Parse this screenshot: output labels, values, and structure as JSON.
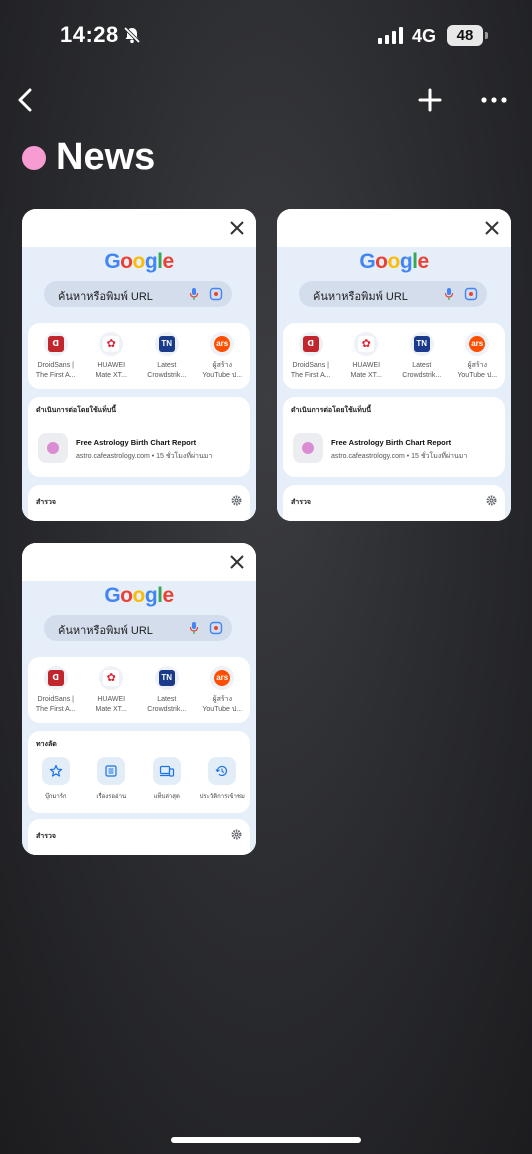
{
  "status_bar": {
    "time": "14:28",
    "network": "4G",
    "battery": "48"
  },
  "group": {
    "title": "News",
    "dot_color": "#f79bd3"
  },
  "tabs": [
    {
      "logo": "Google",
      "search_placeholder": "ค้นหาหรือพิมพ์ URL",
      "sites": [
        {
          "l1": "DroidSans |",
          "l2": "The First A...",
          "icon_text": "ᗡ",
          "color": "#c0262c"
        },
        {
          "l1": "HUAWEI",
          "l2": "Mate XT...",
          "icon_text": "✿",
          "color": "#e02033"
        },
        {
          "l1": "Latest",
          "l2": "Crowdstrik...",
          "icon_text": "TN",
          "color": "#1a3a8c"
        },
        {
          "l1": "ผู้สร้าง",
          "l2": "YouTube ป...",
          "icon_text": "ars",
          "color": "#ff4e00"
        }
      ],
      "panel_title": "ดำเนินการต่อโดยใช้แท็บนี้",
      "resume_title": "Free Astrology Birth Chart Report",
      "resume_sub": "astro.cafeastrology.com • 15 ชั่วโมงที่ผ่านมา",
      "footer": "สำรวจ"
    },
    {
      "logo": "Google",
      "search_placeholder": "ค้นหาหรือพิมพ์ URL",
      "sites": [
        {
          "l1": "DroidSans |",
          "l2": "The First A...",
          "icon_text": "ᗡ",
          "color": "#c0262c"
        },
        {
          "l1": "HUAWEI",
          "l2": "Mate XT...",
          "icon_text": "✿",
          "color": "#e02033"
        },
        {
          "l1": "Latest",
          "l2": "Crowdstrik...",
          "icon_text": "TN",
          "color": "#1a3a8c"
        },
        {
          "l1": "ผู้สร้าง",
          "l2": "YouTube ป...",
          "icon_text": "ars",
          "color": "#ff4e00"
        }
      ],
      "panel_title": "ดำเนินการต่อโดยใช้แท็บนี้",
      "resume_title": "Free Astrology Birth Chart Report",
      "resume_sub": "astro.cafeastrology.com • 15 ชั่วโมงที่ผ่านมา",
      "footer": "สำรวจ"
    },
    {
      "logo": "Google",
      "search_placeholder": "ค้นหาหรือพิมพ์ URL",
      "sites": [
        {
          "l1": "DroidSans |",
          "l2": "The First A...",
          "icon_text": "ᗡ",
          "color": "#c0262c"
        },
        {
          "l1": "HUAWEI",
          "l2": "Mate XT...",
          "icon_text": "✿",
          "color": "#e02033"
        },
        {
          "l1": "Latest",
          "l2": "Crowdstrik...",
          "icon_text": "TN",
          "color": "#1a3a8c"
        },
        {
          "l1": "ผู้สร้าง",
          "l2": "YouTube ป...",
          "icon_text": "ars",
          "color": "#ff4e00"
        }
      ],
      "shortcuts_title": "ทางลัด",
      "shortcuts": [
        {
          "label": "บุ๊กมาร์ก",
          "icon": "star-icon"
        },
        {
          "label": "เรื่องรออ่าน",
          "icon": "reading-list-icon"
        },
        {
          "label": "แท็บล่าสุด",
          "icon": "devices-icon"
        },
        {
          "label": "ประวัติการเข้าชม",
          "icon": "history-icon"
        }
      ],
      "footer": "สำรวจ"
    }
  ]
}
